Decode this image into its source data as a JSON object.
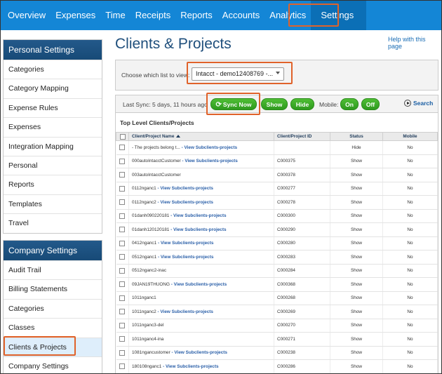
{
  "nav": {
    "items": [
      "Overview",
      "Expenses",
      "Time",
      "Receipts",
      "Reports",
      "Accounts",
      "Analytics",
      "Settings"
    ],
    "active": "Settings"
  },
  "personal_settings": {
    "header": "Personal Settings",
    "items": [
      "Categories",
      "Category Mapping",
      "Expense Rules",
      "Expenses",
      "Integration Mapping",
      "Personal",
      "Reports",
      "Templates",
      "Travel"
    ]
  },
  "company_settings": {
    "header": "Company Settings",
    "items": [
      "Audit Trail",
      "Billing Statements",
      "Categories",
      "Classes",
      "Clients & Projects",
      "Company Settings"
    ],
    "selected": "Clients & Projects"
  },
  "page": {
    "title": "Clients & Projects",
    "help_link": "Help with this page"
  },
  "chooser": {
    "label": "Choose which list to view:",
    "selected_value": "Intacct - demo12408769 -..."
  },
  "toolbar": {
    "last_sync": "Last Sync: 5 days, 11 hours ago",
    "sync_now": "Sync Now",
    "show": "Show",
    "hide": "Hide",
    "mobile_label": "Mobile:",
    "on": "On",
    "off": "Off",
    "search": "Search"
  },
  "table": {
    "section_title": "Top Level Clients/Projects",
    "headers": [
      "Client/Project Name",
      "Client/Project ID",
      "Status",
      "Mobile"
    ],
    "rows": [
      {
        "name": "- The projects belong t...",
        "link": "- View Subclients-projects",
        "id": "",
        "status": "Hide",
        "mobile": "No"
      },
      {
        "name": "000autoIntacctCustomer",
        "link": "- View Subclients-projects",
        "id": "C000375",
        "status": "Show",
        "mobile": "No"
      },
      {
        "name": "003autoIntacctCustomer",
        "link": "",
        "id": "C000378",
        "status": "Show",
        "mobile": "No"
      },
      {
        "name": "0112nganc1",
        "link": "- View Subclients-projects",
        "id": "C000277",
        "status": "Show",
        "mobile": "No"
      },
      {
        "name": "0112nganc2",
        "link": "- View Subclients-projects",
        "id": "C000278",
        "status": "Show",
        "mobile": "No"
      },
      {
        "name": "01danh090220181",
        "link": "- View Subclients-projects",
        "id": "C000300",
        "status": "Show",
        "mobile": "No"
      },
      {
        "name": "01danh120120181",
        "link": "- View Subclients-projects",
        "id": "C000290",
        "status": "Show",
        "mobile": "No"
      },
      {
        "name": "0412nganc1",
        "link": "- View Subclients-projects",
        "id": "C000280",
        "status": "Show",
        "mobile": "No"
      },
      {
        "name": "0512nganc1",
        "link": "- View Subclients-projects",
        "id": "C000283",
        "status": "Show",
        "mobile": "No"
      },
      {
        "name": "0512nganc2-inac",
        "link": "",
        "id": "C000284",
        "status": "Show",
        "mobile": "No"
      },
      {
        "name": "09JAN19THUONG",
        "link": "- View Subclients-projects",
        "id": "C000368",
        "status": "Show",
        "mobile": "No"
      },
      {
        "name": "1011nganc1",
        "link": "",
        "id": "C000268",
        "status": "Show",
        "mobile": "No"
      },
      {
        "name": "1011nganc2",
        "link": "- View Subclients-projects",
        "id": "C000269",
        "status": "Show",
        "mobile": "No"
      },
      {
        "name": "1011nganc3-del",
        "link": "",
        "id": "C000270",
        "status": "Show",
        "mobile": "No"
      },
      {
        "name": "1011nganc4-ina",
        "link": "",
        "id": "C000271",
        "status": "Show",
        "mobile": "No"
      },
      {
        "name": "1081ngancustomer",
        "link": "- View Subclients-projects",
        "id": "C000238",
        "status": "Show",
        "mobile": "No"
      },
      {
        "name": "180108nganc1",
        "link": "- View Subclients-projects",
        "id": "C000286",
        "status": "Show",
        "mobile": "No"
      }
    ]
  },
  "colors": {
    "nav_bg": "#1486d6",
    "sidebar_header": "#1a4f7f",
    "highlight_box": "#e0622a",
    "green_button": "#3aa828"
  }
}
